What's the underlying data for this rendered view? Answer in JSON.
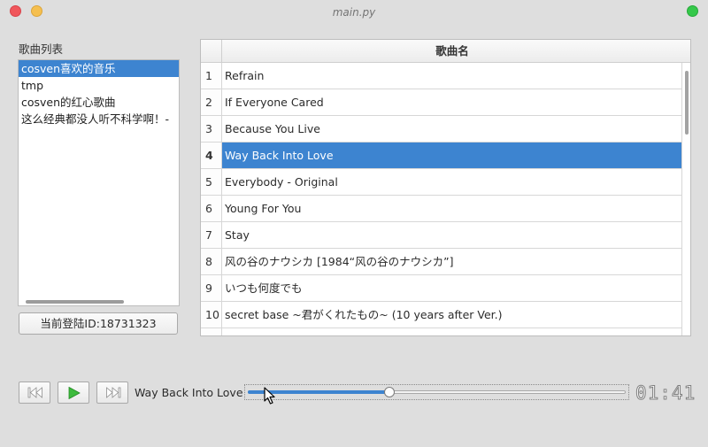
{
  "window": {
    "title": "main.py"
  },
  "playlists": {
    "heading": "歌曲列表",
    "items": [
      {
        "label": "cosven喜欢的音乐",
        "selected": true
      },
      {
        "label": "tmp",
        "selected": false
      },
      {
        "label": "cosven的红心歌曲",
        "selected": false
      },
      {
        "label": "这么经典都没人听不科学啊！-",
        "selected": false
      }
    ]
  },
  "login_button": {
    "label": "当前登陆ID:18731323"
  },
  "song_table": {
    "header": "歌曲名",
    "selected_row": 4,
    "rows": [
      {
        "num": "1",
        "title": "Refrain"
      },
      {
        "num": "2",
        "title": "If Everyone Cared"
      },
      {
        "num": "3",
        "title": "Because You Live"
      },
      {
        "num": "4",
        "title": "Way Back Into Love"
      },
      {
        "num": "5",
        "title": "Everybody - Original"
      },
      {
        "num": "6",
        "title": "Young For You"
      },
      {
        "num": "7",
        "title": "Stay"
      },
      {
        "num": "8",
        "title": "风の谷のナウシカ [1984“风の谷のナウシカ”]"
      },
      {
        "num": "9",
        "title": "いつも何度でも"
      },
      {
        "num": "10",
        "title": " secret base ~君がくれたもの~ (10 years after Ver.)"
      },
      {
        "num": "",
        "title": ""
      }
    ]
  },
  "player": {
    "prev_icon": "skip-previous-icon",
    "play_icon": "play-icon",
    "next_icon": "skip-next-icon",
    "now_playing": "Way Back Into Love",
    "progress_fraction": 0.375,
    "elapsed": "01:41"
  },
  "colors": {
    "accent": "#3d84d0",
    "play_green": "#2fa82f"
  }
}
